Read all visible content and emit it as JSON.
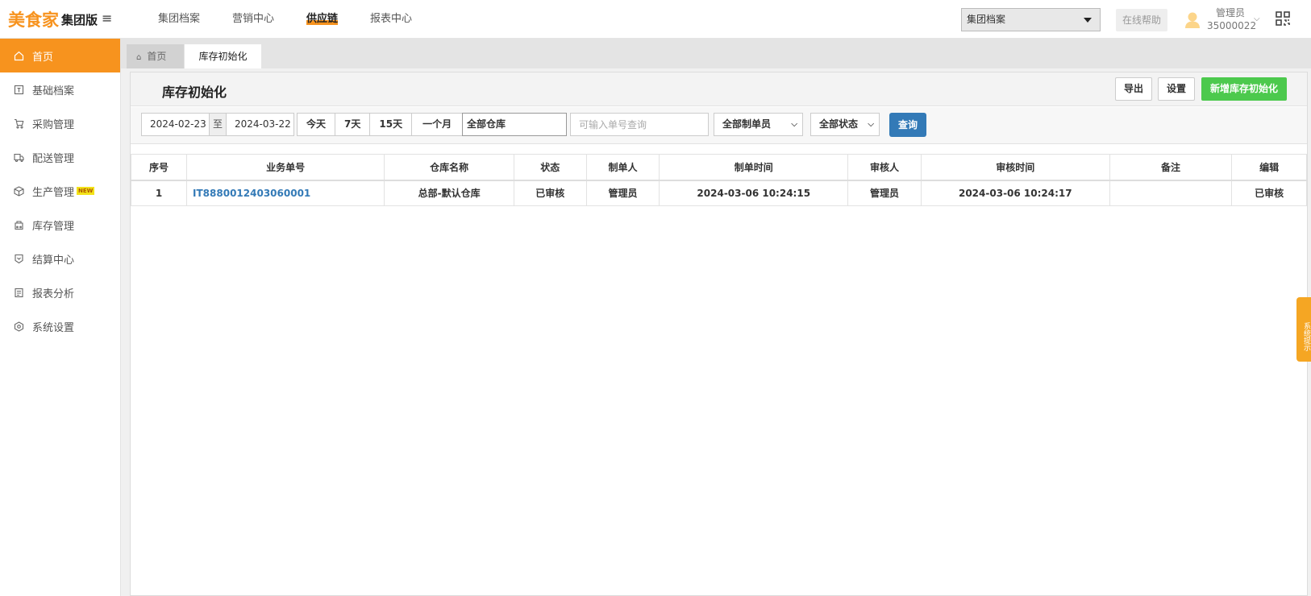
{
  "brand": {
    "logo": "美食家",
    "edition": "集团版",
    "menu_icon": "≡"
  },
  "topnav": [
    "集团档案",
    "营销中心",
    "供应链",
    "报表中心"
  ],
  "topnav_active": "供应链",
  "group_select": "集团档案",
  "help": "在线帮助",
  "user": {
    "name": "管理员",
    "id": "35000022"
  },
  "sidebar": {
    "items": [
      {
        "label": "首页",
        "icon": "home-icon"
      },
      {
        "label": "基础档案",
        "icon": "archive-icon"
      },
      {
        "label": "采购管理",
        "icon": "cart-icon"
      },
      {
        "label": "配送管理",
        "icon": "truck-icon"
      },
      {
        "label": "生产管理",
        "icon": "cube-icon",
        "badge": "NEW"
      },
      {
        "label": "库存管理",
        "icon": "stock-icon"
      },
      {
        "label": "结算中心",
        "icon": "settle-icon"
      },
      {
        "label": "报表分析",
        "icon": "report-icon"
      },
      {
        "label": "系统设置",
        "icon": "gear-icon"
      }
    ]
  },
  "tabs": {
    "home": "首页",
    "current": "库存初始化"
  },
  "page": {
    "title": "库存初始化",
    "export": "导出",
    "settings": "设置",
    "add": "新增库存初始化"
  },
  "filter": {
    "date_from": "2024-02-23",
    "to": "至",
    "date_to": "2024-03-22",
    "quick": [
      "今天",
      "7天",
      "15天",
      "一个月"
    ],
    "warehouse": "全部仓库",
    "search_placeholder": "可输入单号查询",
    "maker": "全部制单员",
    "status": "全部状态",
    "query": "查询"
  },
  "table": {
    "headers": [
      "序号",
      "业务单号",
      "仓库名称",
      "状态",
      "制单人",
      "制单时间",
      "审核人",
      "审核时间",
      "备注",
      "编辑"
    ],
    "rows": [
      {
        "no": "1",
        "order": "IT8880012403060001",
        "warehouse": "总部-默认仓库",
        "status": "已审核",
        "maker": "管理员",
        "make_time": "2024-03-06 10:24:15",
        "auditor": "管理员",
        "audit_time": "2024-03-06 10:24:17",
        "note": "",
        "edit": "已审核"
      }
    ]
  },
  "float_tip": "系统提示",
  "colors": {
    "accent": "#f7931e",
    "add_button": "#4cc94d",
    "query_button": "#337ab7",
    "link": "#337ab7"
  }
}
